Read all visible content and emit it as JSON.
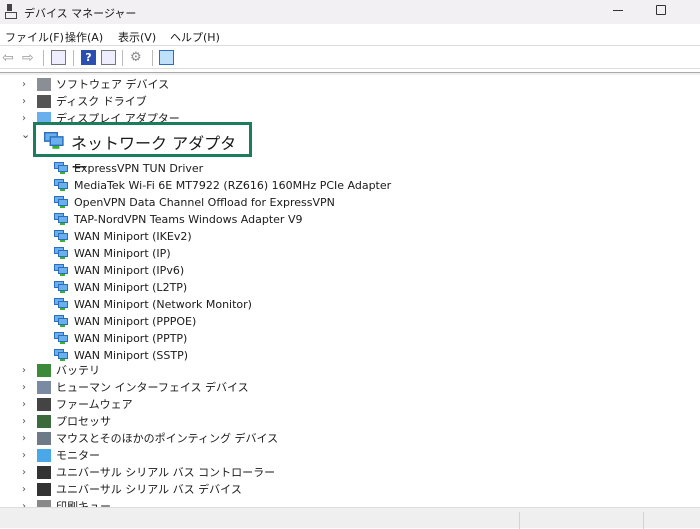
{
  "window": {
    "title": "デバイス マネージャー"
  },
  "menu": [
    "ファイル(F)",
    "操作(A)",
    "表示(V)",
    "ヘルプ(H)"
  ],
  "toolbar": [
    "back-icon",
    "forward-icon",
    "show-hide-console-tree-icon",
    "help-icon",
    "action-pane-icon",
    "update-driver-icon",
    "scan-hardware-icon"
  ],
  "tree_above": [
    {
      "label": "ソフトウェア デバイス",
      "icon": "software-device-icon"
    },
    {
      "label": "ディスク ドライブ",
      "icon": "disk-drive-icon"
    },
    {
      "label": "ディスプレイ アダプター",
      "icon": "display-adapter-icon"
    }
  ],
  "expanded": {
    "label": "ネットワーク アダプター",
    "icon": "network-adapter-icon"
  },
  "adapters": [
    "ExpressVPN TUN Driver",
    "MediaTek Wi-Fi 6E MT7922 (RZ616) 160MHz PCIe Adapter",
    "OpenVPN Data Channel Offload for ExpressVPN",
    "TAP-NordVPN Teams Windows Adapter V9",
    "WAN Miniport (IKEv2)",
    "WAN Miniport (IP)",
    "WAN Miniport (IPv6)",
    "WAN Miniport (L2TP)",
    "WAN Miniport (Network Monitor)",
    "WAN Miniport (PPPOE)",
    "WAN Miniport (PPTP)",
    "WAN Miniport (SSTP)"
  ],
  "tree_below": [
    {
      "label": "バッテリ",
      "icon": "battery-icon"
    },
    {
      "label": "ヒューマン インターフェイス デバイス",
      "icon": "hid-icon"
    },
    {
      "label": "ファームウェア",
      "icon": "firmware-icon"
    },
    {
      "label": "プロセッサ",
      "icon": "processor-icon"
    },
    {
      "label": "マウスとそのほかのポインティング デバイス",
      "icon": "mouse-icon"
    },
    {
      "label": "モニター",
      "icon": "monitor-icon"
    },
    {
      "label": "ユニバーサル シリアル バス コントローラー",
      "icon": "usb-icon"
    },
    {
      "label": "ユニバーサル シリアル バス デバイス",
      "icon": "usb-icon"
    },
    {
      "label": "印刷キュー",
      "icon": "printer-icon"
    }
  ],
  "highlight_color": "#1b7d5c"
}
